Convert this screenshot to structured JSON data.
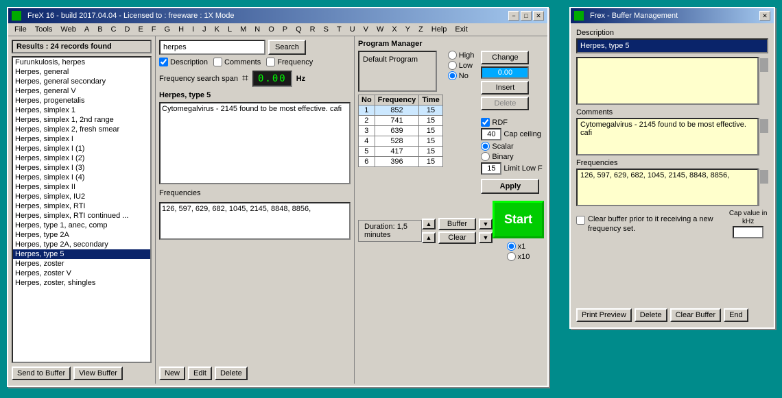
{
  "mainWindow": {
    "title": "FreX 16 - build 2017.04.04 - Licensed to : freeware  :  1X Mode",
    "minimizeBtn": "−",
    "maximizeBtn": "□",
    "closeBtn": "✕",
    "menu": [
      "File",
      "Tools",
      "Web",
      "A",
      "B",
      "C",
      "D",
      "E",
      "F",
      "G",
      "H",
      "I",
      "J",
      "K",
      "L",
      "M",
      "N",
      "O",
      "P",
      "Q",
      "R",
      "S",
      "T",
      "U",
      "V",
      "W",
      "X",
      "Y",
      "Z",
      "Help",
      "Exit"
    ]
  },
  "results": {
    "header": "Results : 24 records found",
    "items": [
      "Furunkulosis, herpes",
      "Herpes, general",
      "Herpes, general secondary",
      "Herpes, general V",
      "Herpes, progenetalis",
      "Herpes, simplex 1",
      "Herpes, simplex 1, 2nd range",
      "Herpes, simplex 2, fresh smear",
      "Herpes, simplex I",
      "Herpes, simplex I (1)",
      "Herpes, simplex I (2)",
      "Herpes, simplex I (3)",
      "Herpes, simplex I (4)",
      "Herpes, simplex II",
      "Herpes, simplex, IU2",
      "Herpes, simplex, RTI",
      "Herpes, simplex, RTI continued ...",
      "Herpes, type 1, anec, comp",
      "Herpes, type 2A",
      "Herpes, type 2A, secondary",
      "Herpes, type 5",
      "Herpes, zoster",
      "Herpes, zoster V",
      "Herpes, zoster, shingles"
    ],
    "selectedIndex": 20,
    "sendToBuffer": "Send to Buffer",
    "viewBuffer": "View Buffer"
  },
  "search": {
    "value": "herpes",
    "placeholder": "herpes",
    "searchBtn": "Search",
    "descriptionCheck": true,
    "descriptionLabel": "Description",
    "commentsCheck": false,
    "commentsLabel": "Comments",
    "frequencyCheck": false,
    "frequencyLabel": "Frequency",
    "freqSpanLabel": "Frequency search span",
    "freqDisplay": "0.00",
    "freqUnit": "Hz"
  },
  "recordDetail": {
    "name": "Herpes, type 5",
    "description": "Cytomegalvirus - 2145 found to be most effective. cafi",
    "frequenciesLabel": "Frequencies",
    "frequencies": "126, 597, 629, 682, 1045, 2145, 8848, 8856,",
    "newBtn": "New",
    "editBtn": "Edit",
    "deleteBtn": "Delete"
  },
  "programManager": {
    "label": "Program Manager",
    "defaultProgram": "Default Program",
    "radioHigh": "High",
    "radioLow": "Low",
    "radioNo": "No",
    "radioNoSelected": true,
    "radioHighSelected": false,
    "table": {
      "headers": [
        "No",
        "Frequency",
        "Time"
      ],
      "rows": [
        {
          "no": "1",
          "freq": "852",
          "time": "15"
        },
        {
          "no": "2",
          "freq": "741",
          "time": "15"
        },
        {
          "no": "3",
          "freq": "639",
          "time": "15"
        },
        {
          "no": "4",
          "freq": "528",
          "time": "15"
        },
        {
          "no": "5",
          "freq": "417",
          "time": "15"
        },
        {
          "no": "6",
          "freq": "396",
          "time": "15"
        }
      ]
    },
    "changeBtn": "Change",
    "valueInput": "0.00",
    "insertBtn": "Insert",
    "deleteBtn": "Delete",
    "rdfCheck": true,
    "rdfLabel": "RDF",
    "capCeilingLabel": "Cap ceiling",
    "capCeilingValue": "40",
    "scalarRadio": true,
    "scalarLabel": "Scalar",
    "binaryRadio": false,
    "binaryLabel": "Binary",
    "limitLabel": "Limit Low F",
    "limitValue": "15",
    "applyBtn": "Apply",
    "duration": "Duration: 1,5 minutes",
    "bufferBtn": "Buffer",
    "clearBtn": "Clear",
    "startBtn": "Start",
    "x1Radio": true,
    "x1Label": "x1",
    "x10Radio": false,
    "x10Label": "x10"
  },
  "bufferWindow": {
    "title": "Frex - Buffer Management",
    "closeBtn": "✕",
    "descriptionLabel": "Description",
    "descriptionValue": "Herpes, type 5",
    "descAreaContent": "",
    "commentsLabel": "Comments",
    "commentsContent": "Cytomegalvirus - 2145 found to be most effective. cafi",
    "frequenciesLabel": "Frequencies",
    "frequenciesContent": "126, 597, 629, 682, 1045, 2145, 8848, 8856,",
    "clearBufferPrior": false,
    "clearBufferLabel": "Clear buffer prior to it receiving a new frequency set.",
    "capValueLabel": "Cap value in kHz",
    "capValueInput": "",
    "printPreviewBtn": "Print Preview",
    "deleteBtn": "Delete",
    "clearBufferBtn": "Clear Buffer",
    "endBtn": "End"
  }
}
